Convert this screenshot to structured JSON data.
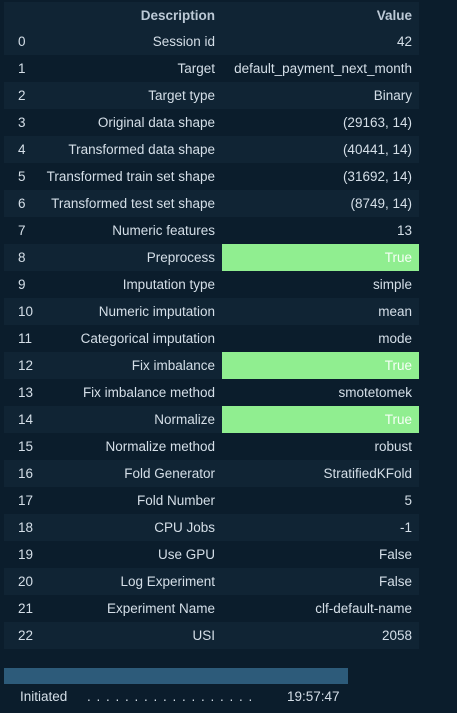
{
  "table": {
    "headers": {
      "index": "",
      "description": "Description",
      "value": "Value"
    },
    "highlight_color": "#90ee90",
    "rows": [
      {
        "index": "0",
        "description": "Session id",
        "value": "42",
        "highlight": false
      },
      {
        "index": "1",
        "description": "Target",
        "value": "default_payment_next_month",
        "highlight": false
      },
      {
        "index": "2",
        "description": "Target type",
        "value": "Binary",
        "highlight": false
      },
      {
        "index": "3",
        "description": "Original data shape",
        "value": "(29163, 14)",
        "highlight": false
      },
      {
        "index": "4",
        "description": "Transformed data shape",
        "value": "(40441, 14)",
        "highlight": false
      },
      {
        "index": "5",
        "description": "Transformed train set shape",
        "value": "(31692, 14)",
        "highlight": false
      },
      {
        "index": "6",
        "description": "Transformed test set shape",
        "value": "(8749, 14)",
        "highlight": false
      },
      {
        "index": "7",
        "description": "Numeric features",
        "value": "13",
        "highlight": false
      },
      {
        "index": "8",
        "description": "Preprocess",
        "value": "True",
        "highlight": true
      },
      {
        "index": "9",
        "description": "Imputation type",
        "value": "simple",
        "highlight": false
      },
      {
        "index": "10",
        "description": "Numeric imputation",
        "value": "mean",
        "highlight": false
      },
      {
        "index": "11",
        "description": "Categorical imputation",
        "value": "mode",
        "highlight": false
      },
      {
        "index": "12",
        "description": "Fix imbalance",
        "value": "True",
        "highlight": true
      },
      {
        "index": "13",
        "description": "Fix imbalance method",
        "value": "smotetomek",
        "highlight": false
      },
      {
        "index": "14",
        "description": "Normalize",
        "value": "True",
        "highlight": true
      },
      {
        "index": "15",
        "description": "Normalize method",
        "value": "robust",
        "highlight": false
      },
      {
        "index": "16",
        "description": "Fold Generator",
        "value": "StratifiedKFold",
        "highlight": false
      },
      {
        "index": "17",
        "description": "Fold Number",
        "value": "5",
        "highlight": false
      },
      {
        "index": "18",
        "description": "CPU Jobs",
        "value": "-1",
        "highlight": false
      },
      {
        "index": "19",
        "description": "Use GPU",
        "value": "False",
        "highlight": false
      },
      {
        "index": "20",
        "description": "Log Experiment",
        "value": "False",
        "highlight": false
      },
      {
        "index": "21",
        "description": "Experiment Name",
        "value": "clf-default-name",
        "highlight": false
      },
      {
        "index": "22",
        "description": "USI",
        "value": "2058",
        "highlight": false
      }
    ]
  },
  "progress": {
    "fraction": 1.0
  },
  "status": {
    "label": "Initiated",
    "dots": ". . . . . . . . . . . . . . . . . .",
    "time": "19:57:47"
  }
}
